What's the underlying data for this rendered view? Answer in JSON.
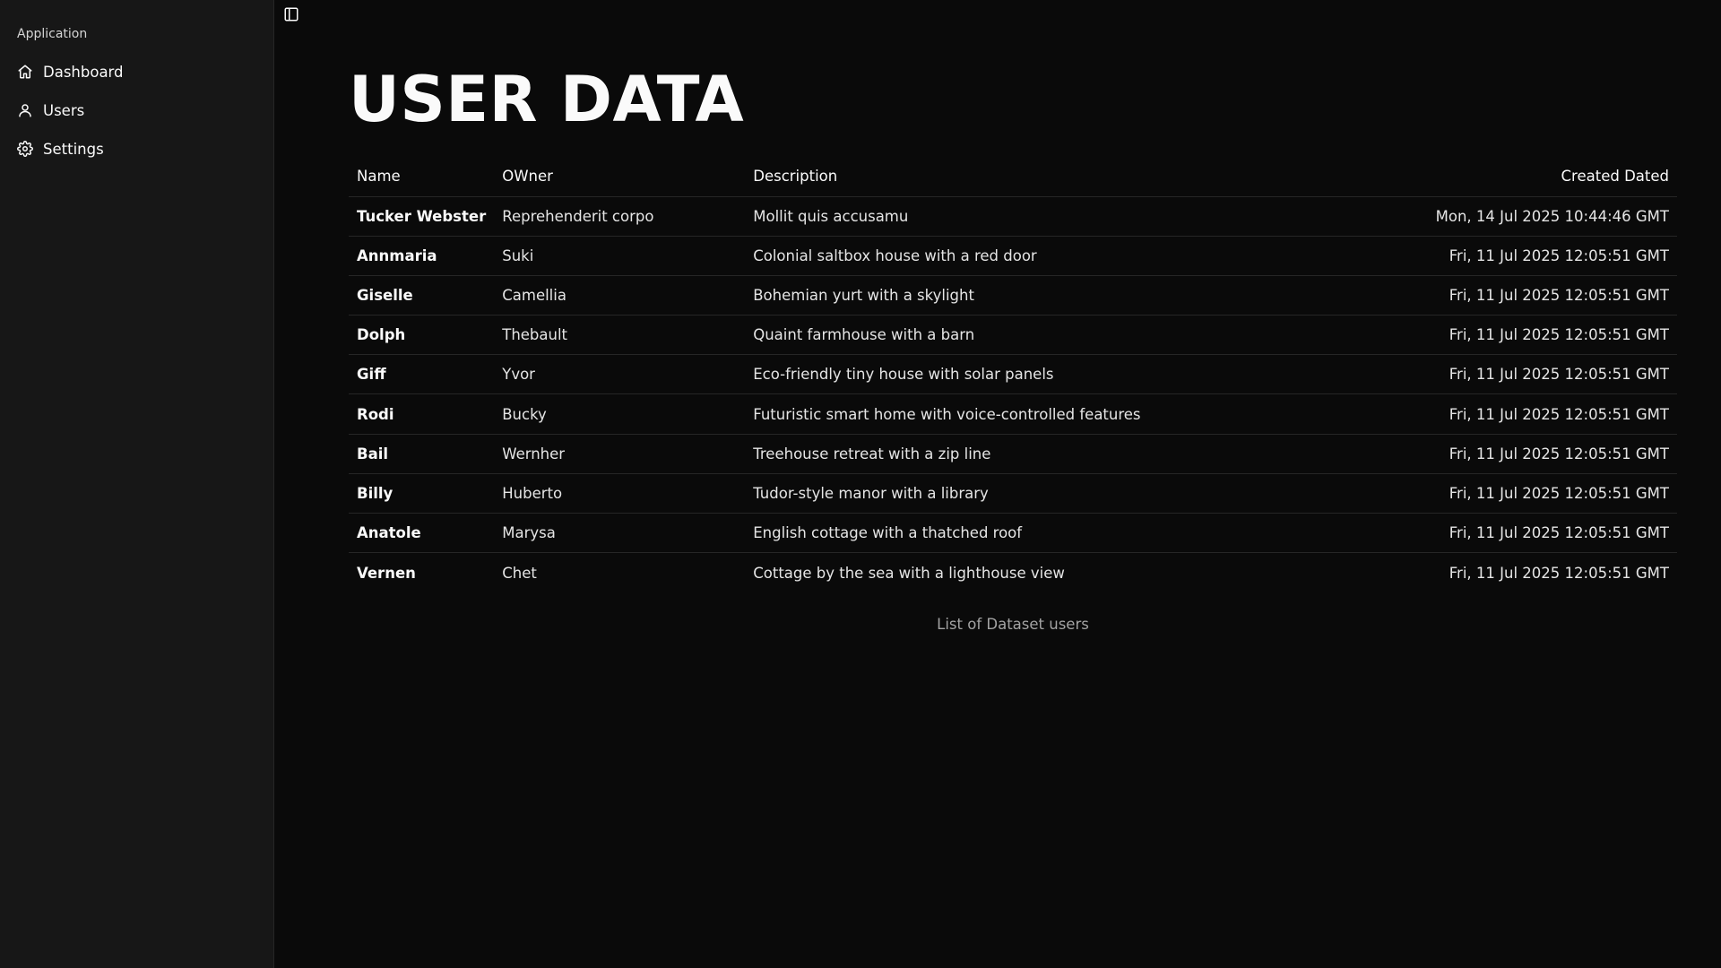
{
  "sidebar": {
    "group_label": "Application",
    "items": [
      {
        "label": "Dashboard",
        "icon": "home-icon"
      },
      {
        "label": "Users",
        "icon": "user-icon"
      },
      {
        "label": "Settings",
        "icon": "gear-icon"
      }
    ]
  },
  "main": {
    "title": "USER DATA",
    "table": {
      "headers": {
        "name": "Name",
        "owner": "OWner",
        "description": "Description",
        "created": "Created Dated"
      },
      "rows": [
        {
          "name": "Tucker Webster",
          "owner": "Reprehenderit corpo",
          "description": "Mollit quis accusamu",
          "created": "Mon, 14 Jul 2025 10:44:46 GMT"
        },
        {
          "name": "Annmaria",
          "owner": "Suki",
          "description": "Colonial saltbox house with a red door",
          "created": "Fri, 11 Jul 2025 12:05:51 GMT"
        },
        {
          "name": "Giselle",
          "owner": "Camellia",
          "description": "Bohemian yurt with a skylight",
          "created": "Fri, 11 Jul 2025 12:05:51 GMT"
        },
        {
          "name": "Dolph",
          "owner": "Thebault",
          "description": "Quaint farmhouse with a barn",
          "created": "Fri, 11 Jul 2025 12:05:51 GMT"
        },
        {
          "name": "Giff",
          "owner": "Yvor",
          "description": "Eco-friendly tiny house with solar panels",
          "created": "Fri, 11 Jul 2025 12:05:51 GMT"
        },
        {
          "name": "Rodi",
          "owner": "Bucky",
          "description": "Futuristic smart home with voice-controlled features",
          "created": "Fri, 11 Jul 2025 12:05:51 GMT"
        },
        {
          "name": "Bail",
          "owner": "Wernher",
          "description": "Treehouse retreat with a zip line",
          "created": "Fri, 11 Jul 2025 12:05:51 GMT"
        },
        {
          "name": "Billy",
          "owner": "Huberto",
          "description": "Tudor-style manor with a library",
          "created": "Fri, 11 Jul 2025 12:05:51 GMT"
        },
        {
          "name": "Anatole",
          "owner": "Marysa",
          "description": "English cottage with a thatched roof",
          "created": "Fri, 11 Jul 2025 12:05:51 GMT"
        },
        {
          "name": "Vernen",
          "owner": "Chet",
          "description": "Cottage by the sea with a lighthouse view",
          "created": "Fri, 11 Jul 2025 12:05:51 GMT"
        }
      ],
      "caption": "List of Dataset users"
    }
  },
  "toggle_icon": "sidebar-toggle-icon",
  "colors": {
    "background": "#0a0a0a",
    "sidebar_bg": "#171717",
    "border": "#262626",
    "text": "#fafafa",
    "muted_text": "#a3a3a3"
  }
}
